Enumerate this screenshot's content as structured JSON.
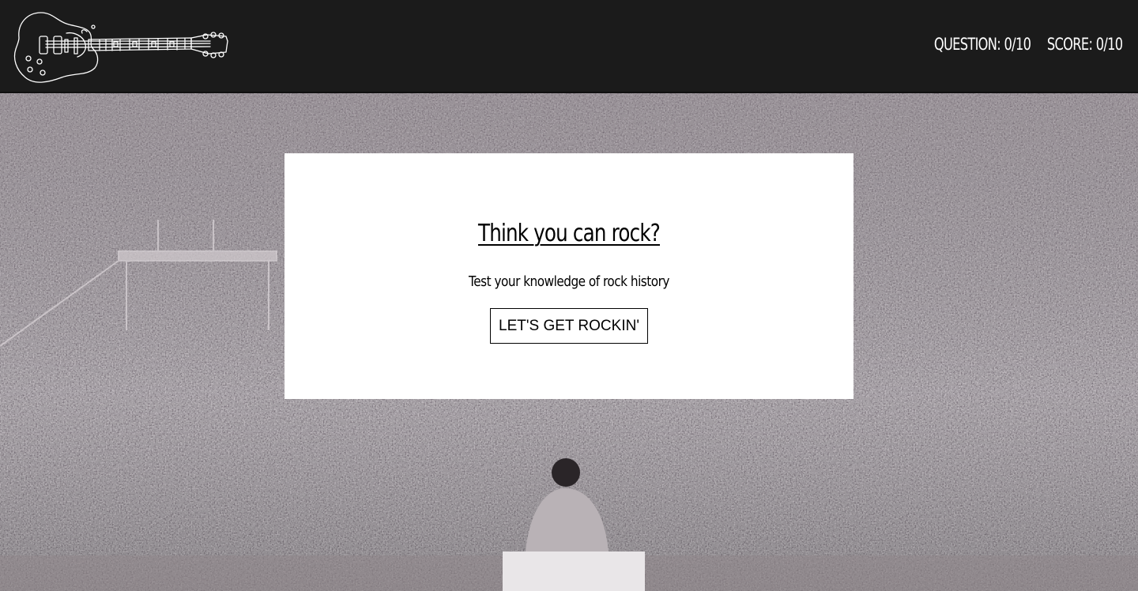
{
  "header": {
    "logo_icon": "electric-guitar-icon",
    "question_counter": "QUESTION: 0/10",
    "score_counter": "SCORE: 0/10"
  },
  "background": {
    "image": "festival-crowd-photo"
  },
  "intro": {
    "title": "Think you can rock?",
    "subtitle": "Test your knowledge of rock history",
    "start_label": "LET'S GET ROCKIN'"
  },
  "colors": {
    "header_bg": "#1b1b1b",
    "header_text": "#ffffff",
    "card_bg": "#ffffff",
    "card_text": "#000000"
  }
}
